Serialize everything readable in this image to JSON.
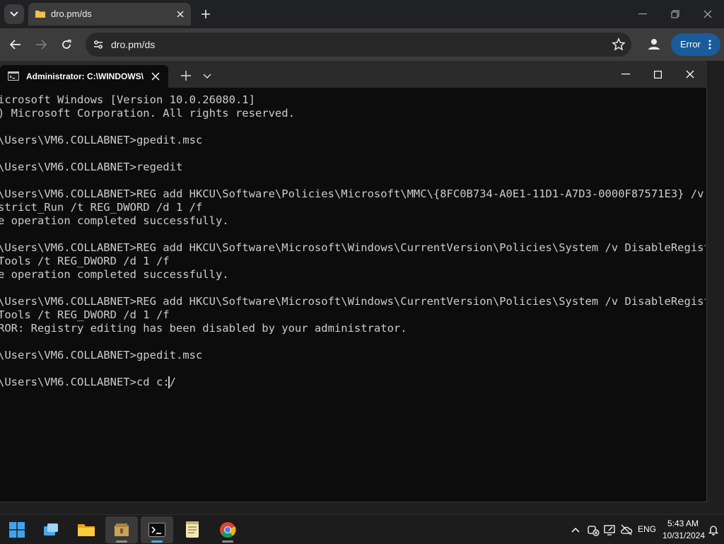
{
  "browser": {
    "tab_title": "dro.pm/ds",
    "url": "dro.pm/ds",
    "profile_button_label": "Error"
  },
  "terminal": {
    "tab_title": "Administrator: C:\\WINDOWS\\",
    "lines": [
      "icrosoft Windows [Version 10.0.26080.1]",
      ") Microsoft Corporation. All rights reserved.",
      "",
      "\\Users\\VM6.COLLABNET>gpedit.msc",
      "",
      "\\Users\\VM6.COLLABNET>regedit",
      "",
      "\\Users\\VM6.COLLABNET>REG add HKCU\\Software\\Policies\\Microsoft\\MMC\\{8FC0B734-A0E1-11D1-A7D3-0000F87571E3} /v",
      "strict_Run /t REG_DWORD /d 1 /f",
      "e operation completed successfully.",
      "",
      "\\Users\\VM6.COLLABNET>REG add HKCU\\Software\\Microsoft\\Windows\\CurrentVersion\\Policies\\System /v DisableRegist",
      "Tools /t REG_DWORD /d 1 /f",
      "e operation completed successfully.",
      "",
      "\\Users\\VM6.COLLABNET>REG add HKCU\\Software\\Microsoft\\Windows\\CurrentVersion\\Policies\\System /v DisableRegist",
      "Tools /t REG_DWORD /d 1 /f",
      "ROR: Registry editing has been disabled by your administrator.",
      "",
      "\\Users\\VM6.COLLABNET>gpedit.msc",
      "",
      "\\Users\\VM6.COLLABNET>cd c:/"
    ]
  },
  "taskbar": {
    "items": [
      "start-icon",
      "task-view-icon",
      "file-explorer-icon",
      "archive-app-icon",
      "terminal-app-icon",
      "notepad-icon",
      "chrome-icon"
    ],
    "language": "ENG",
    "time": "5:43 AM",
    "date": "10/31/2024"
  },
  "colors": {
    "accent_button": "#1a5b9c",
    "terminal_bg": "#0c0c0c",
    "terminal_text": "#cccccc"
  }
}
